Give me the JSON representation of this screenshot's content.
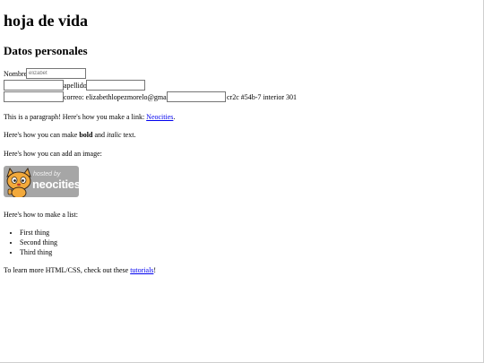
{
  "page": {
    "title": "hoja de vida",
    "section_title": "Datos personales"
  },
  "form": {
    "nombre_label": "Nombre:",
    "nombre_placeholder": "elizabet",
    "apellido_label": "apellido:",
    "correo_label": "correo: elizabethlopezmorelo@gmail.com",
    "direccion_text": "cr2c #54b-7 interior 301"
  },
  "content": {
    "paragraph_prefix": "This is a paragraph! Here's how you make a link:",
    "link_text": "Neocities",
    "paragraph_suffix": ".",
    "format_prefix": "Here's how you can make",
    "bold_text": "bold",
    "format_and": "and",
    "italic_text": "italic",
    "format_suffix": "text.",
    "image_line": "Here's how you can add an image:",
    "list_intro": "Here's how to make a list:",
    "list_items": [
      "First thing",
      "Second thing",
      "Third thing"
    ],
    "learn_prefix": "To learn more HTML/CSS, check out these",
    "tutorials_link": "tutorials",
    "learn_suffix": "!"
  },
  "badge": {
    "line1": "hosted by",
    "line2": "neocities",
    "colors": {
      "bg": "#a6a6a6",
      "cat": "#f2a93b"
    }
  }
}
